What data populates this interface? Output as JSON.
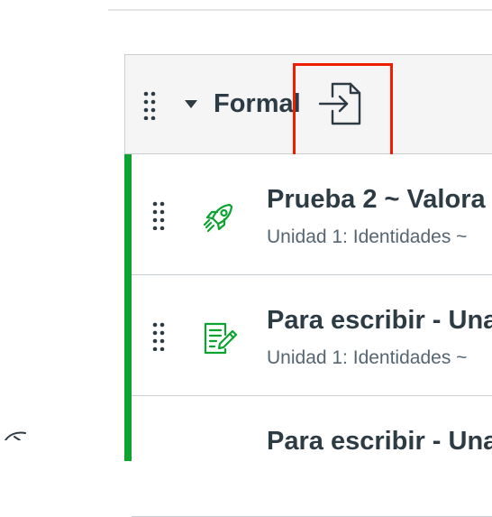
{
  "module": {
    "title": "Formal",
    "items": [
      {
        "title": "Prueba 2 ~ Valora",
        "subtitle": "Unidad 1: Identidades ~",
        "icon": "quiz-rocket-icon",
        "status_color": "#0ca330"
      },
      {
        "title": "Para escribir - Una",
        "subtitle": "Unidad 1: Identidades ~",
        "icon": "assignment-icon",
        "status_color": "#0ca330"
      },
      {
        "title": "Para escribir - Una",
        "subtitle": "",
        "icon": "assignment-icon",
        "status_color": "#0ca330"
      }
    ]
  },
  "colors": {
    "accent_green": "#0ca330",
    "highlight_red": "#f01e00",
    "text_dark": "#2d3b45",
    "text_muted": "#556572"
  }
}
